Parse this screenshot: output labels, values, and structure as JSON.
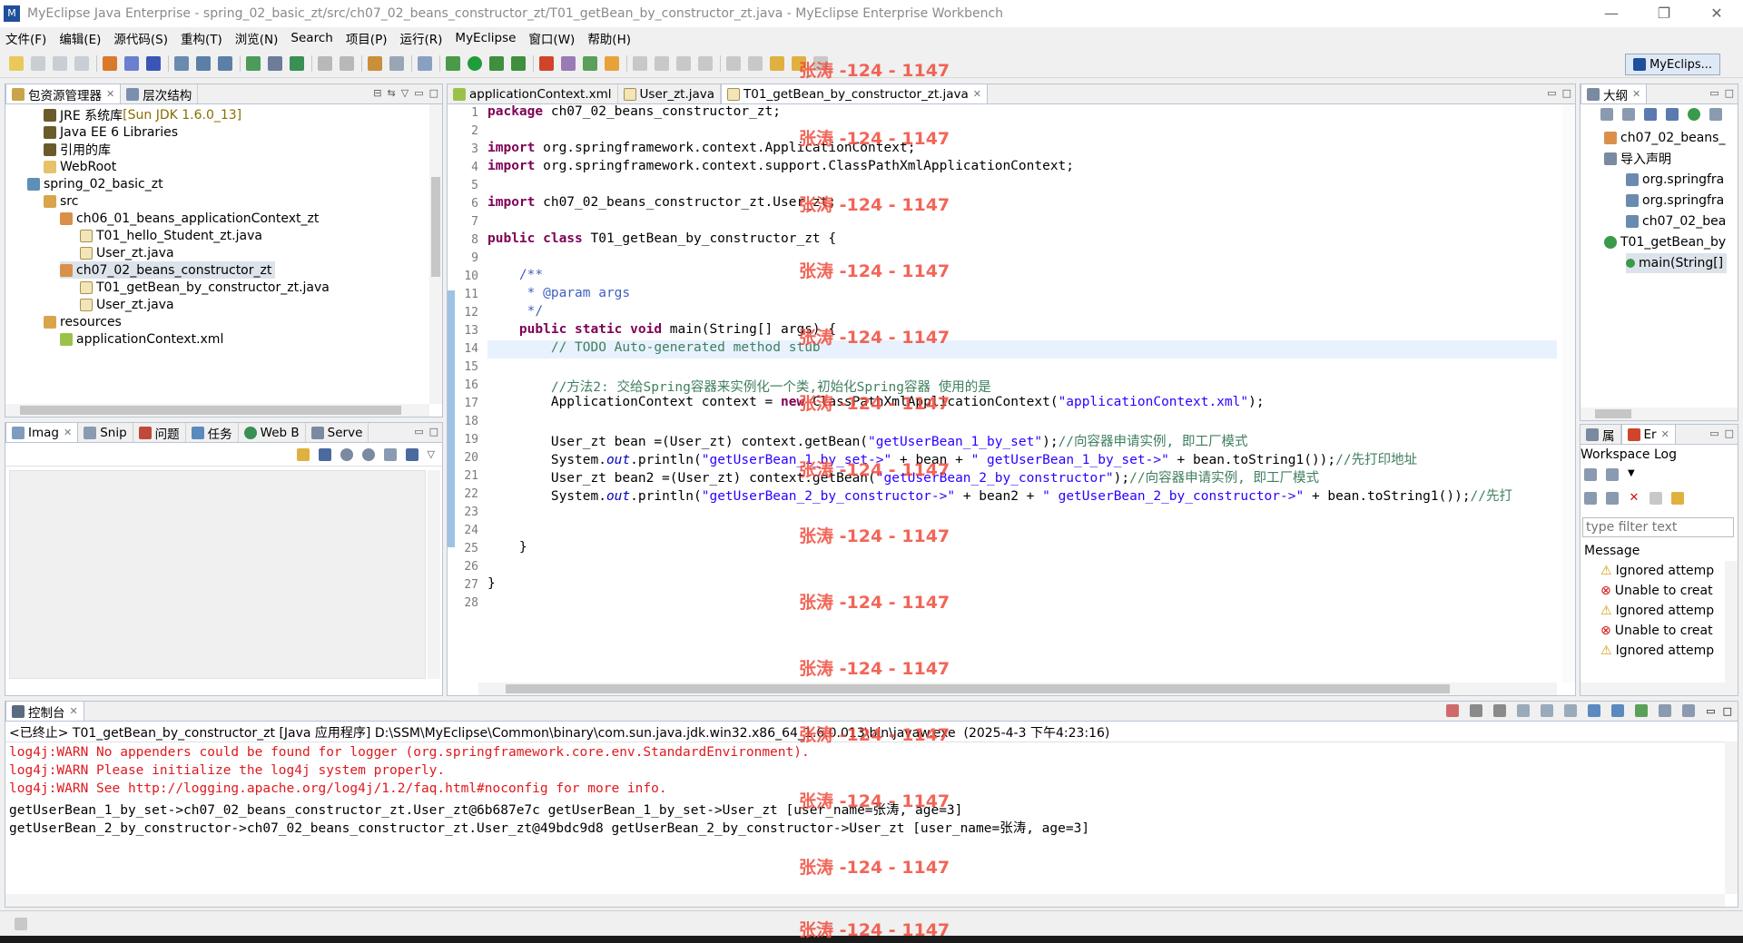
{
  "window": {
    "title": "MyEclipse Java Enterprise  -  spring_02_basic_zt/src/ch07_02_beans_constructor_zt/T01_getBean_by_constructor_zt.java  -  MyEclipse Enterprise Workbench",
    "minimize": "—",
    "maximize": "❐",
    "close": "✕"
  },
  "menu": [
    "文件(F)",
    "编辑(E)",
    "源代码(S)",
    "重构(T)",
    "浏览(N)",
    "Search",
    "项目(P)",
    "运行(R)",
    "MyEclipse",
    "窗口(W)",
    "帮助(H)"
  ],
  "perspective": {
    "label": "MyEclips..."
  },
  "explorer": {
    "tabs": [
      {
        "label": "包资源管理器",
        "close": "✕"
      },
      {
        "label": "层次结构",
        "close": ""
      }
    ],
    "items": [
      {
        "label": "JRE 系统库",
        "extra": "[Sun JDK 1.6.0_13]"
      },
      {
        "label": "Java EE 6 Libraries"
      },
      {
        "label": "引用的库"
      },
      {
        "label": "WebRoot"
      },
      {
        "label": "spring_02_basic_zt"
      },
      {
        "label": "src"
      },
      {
        "label": "ch06_01_beans_applicationContext_zt"
      },
      {
        "label": "T01_hello_Student_zt.java"
      },
      {
        "label": "User_zt.java"
      },
      {
        "label": "ch07_02_beans_constructor_zt"
      },
      {
        "label": "T01_getBean_by_constructor_zt.java"
      },
      {
        "label": "User_zt.java"
      },
      {
        "label": "resources"
      },
      {
        "label": "applicationContext.xml"
      }
    ]
  },
  "image_panel": {
    "tabs": [
      {
        "label": "Imag",
        "close": "✕"
      },
      {
        "label": "Snip"
      },
      {
        "label": "问题"
      },
      {
        "label": "任务"
      },
      {
        "label": "Web B"
      },
      {
        "label": "Serve"
      }
    ]
  },
  "editor": {
    "tabs": [
      {
        "label": "applicationContext.xml"
      },
      {
        "label": "User_zt.java"
      },
      {
        "label": "T01_getBean_by_constructor_zt.java",
        "close": "✕"
      }
    ],
    "line_numbers": [
      "1",
      "2",
      "3",
      "4",
      "5",
      "6",
      "7",
      "8",
      "9",
      "10",
      "11",
      "12",
      "13",
      "14",
      "15",
      "16",
      "17",
      "18",
      "19",
      "20",
      "21",
      "22",
      "23",
      "24",
      "25",
      "26",
      "27",
      "28"
    ],
    "code": {
      "l1a": "package",
      "l1b": " ch07_02_beans_constructor_zt;",
      "l3a": "import",
      "l3b": " org.springframework.context.ApplicationContext;",
      "l4a": "import",
      "l4b": " org.springframework.context.support.ClassPathXmlApplicationContext;",
      "l6a": "import",
      "l6b": " ch07_02_beans_constructor_zt.User_zt;",
      "l8a": "public class",
      "l8b": " T01_getBean_by_constructor_zt {",
      "l10": "    /**",
      "l11": "     * @param args",
      "l12": "     */",
      "l13a": "    public static void",
      "l13b": " main(String[] args) {",
      "l14": "        // TODO Auto-generated method stub",
      "l16": "        //方法2: 交给Spring容器来实例化一个类,初始化Spring容器 使用的是",
      "l17a": "        ApplicationContext context = ",
      "l17b": "new",
      "l17c": " ClassPathXmlApplicationContext(",
      "l17d": "\"applicationContext.xml\"",
      "l17e": ");",
      "l19a": "        User_zt bean =(User_zt) context.getBean(",
      "l19b": "\"getUserBean_1_by_set\"",
      "l19c": ");",
      "l19d": "//向容器申请实例, 即工厂模式",
      "l20a": "        System.",
      "l20b": "out",
      "l20c": ".println(",
      "l20d": "\"getUserBean_1_by_set->\"",
      "l20e": " + bean + ",
      "l20f": "\" getUserBean_1_by_set->\"",
      "l20g": " + bean.toString1());",
      "l20h": "//先打印地址",
      "l21a": "        User_zt bean2 =(User_zt) context.getBean(",
      "l21b": "\"getUserBean_2_by_constructor\"",
      "l21c": ");",
      "l21d": "//向容器申请实例, 即工厂模式",
      "l22a": "        System.",
      "l22b": "out",
      "l22c": ".println(",
      "l22d": "\"getUserBean_2_by_constructor->\"",
      "l22e": " + bean2 + ",
      "l22f": "\" getUserBean_2_by_constructor->\"",
      "l22g": " + bean.toString1());",
      "l22h": "//先打",
      "l25": "    }",
      "l27": "}"
    }
  },
  "outline": {
    "tabs": [
      {
        "label": "大纲",
        "close": "✕"
      }
    ],
    "items": [
      {
        "label": "ch07_02_beans_"
      },
      {
        "label": "导入声明"
      },
      {
        "label": "org.springfra"
      },
      {
        "label": "org.springfra"
      },
      {
        "label": "ch07_02_bea"
      },
      {
        "label": "T01_getBean_by"
      },
      {
        "label": "main(String[]"
      }
    ]
  },
  "log": {
    "tabs": [
      {
        "label": "属"
      },
      {
        "label": "Er",
        "close": "✕"
      }
    ],
    "title": "Workspace Log",
    "filter_placeholder": "type filter text",
    "column": "Message",
    "items": [
      {
        "label": "Ignored attemp",
        "level": "warn"
      },
      {
        "label": "Unable to creat",
        "level": "error"
      },
      {
        "label": "Ignored attemp",
        "level": "warn"
      },
      {
        "label": "Unable to creat",
        "level": "error"
      },
      {
        "label": "Ignored attemp",
        "level": "warn"
      }
    ]
  },
  "console": {
    "tabs": [
      {
        "label": "控制台",
        "close": "✕"
      }
    ],
    "header": "<已终止> T01_getBean_by_constructor_zt [Java 应用程序] D:\\SSM\\MyEclipse\\Common\\binary\\com.sun.java.jdk.win32.x86_64_1.6.0.013\\bin\\javaw.exe  (2025-4-3 下午4:23:16)",
    "lines": [
      {
        "text": "log4j:WARN No appenders could be found for logger (org.springframework.core.env.StandardEnvironment).",
        "level": "warn"
      },
      {
        "text": "log4j:WARN Please initialize the log4j system properly.",
        "level": "warn"
      },
      {
        "text": "log4j:WARN See http://logging.apache.org/log4j/1.2/faq.html#noconfig for more info.",
        "level": "warn"
      },
      {
        "text": "getUserBean_1_by_set->ch07_02_beans_constructor_zt.User_zt@6b687e7c getUserBean_1_by_set->User_zt [user_name=张涛, age=3]",
        "level": "out"
      },
      {
        "text": "getUserBean_2_by_constructor->ch07_02_beans_constructor_zt.User_zt@49bdc9d8 getUserBean_2_by_constructor->User_zt [user_name=张涛, age=3]",
        "level": "out"
      }
    ]
  },
  "watermark": "张涛 -124 - 1147",
  "colors": {
    "keyword": "#7f0055",
    "string": "#2a00ff",
    "comment": "#3f7f5f",
    "warn": "#e0191e",
    "watermark": "#f04b3c"
  }
}
